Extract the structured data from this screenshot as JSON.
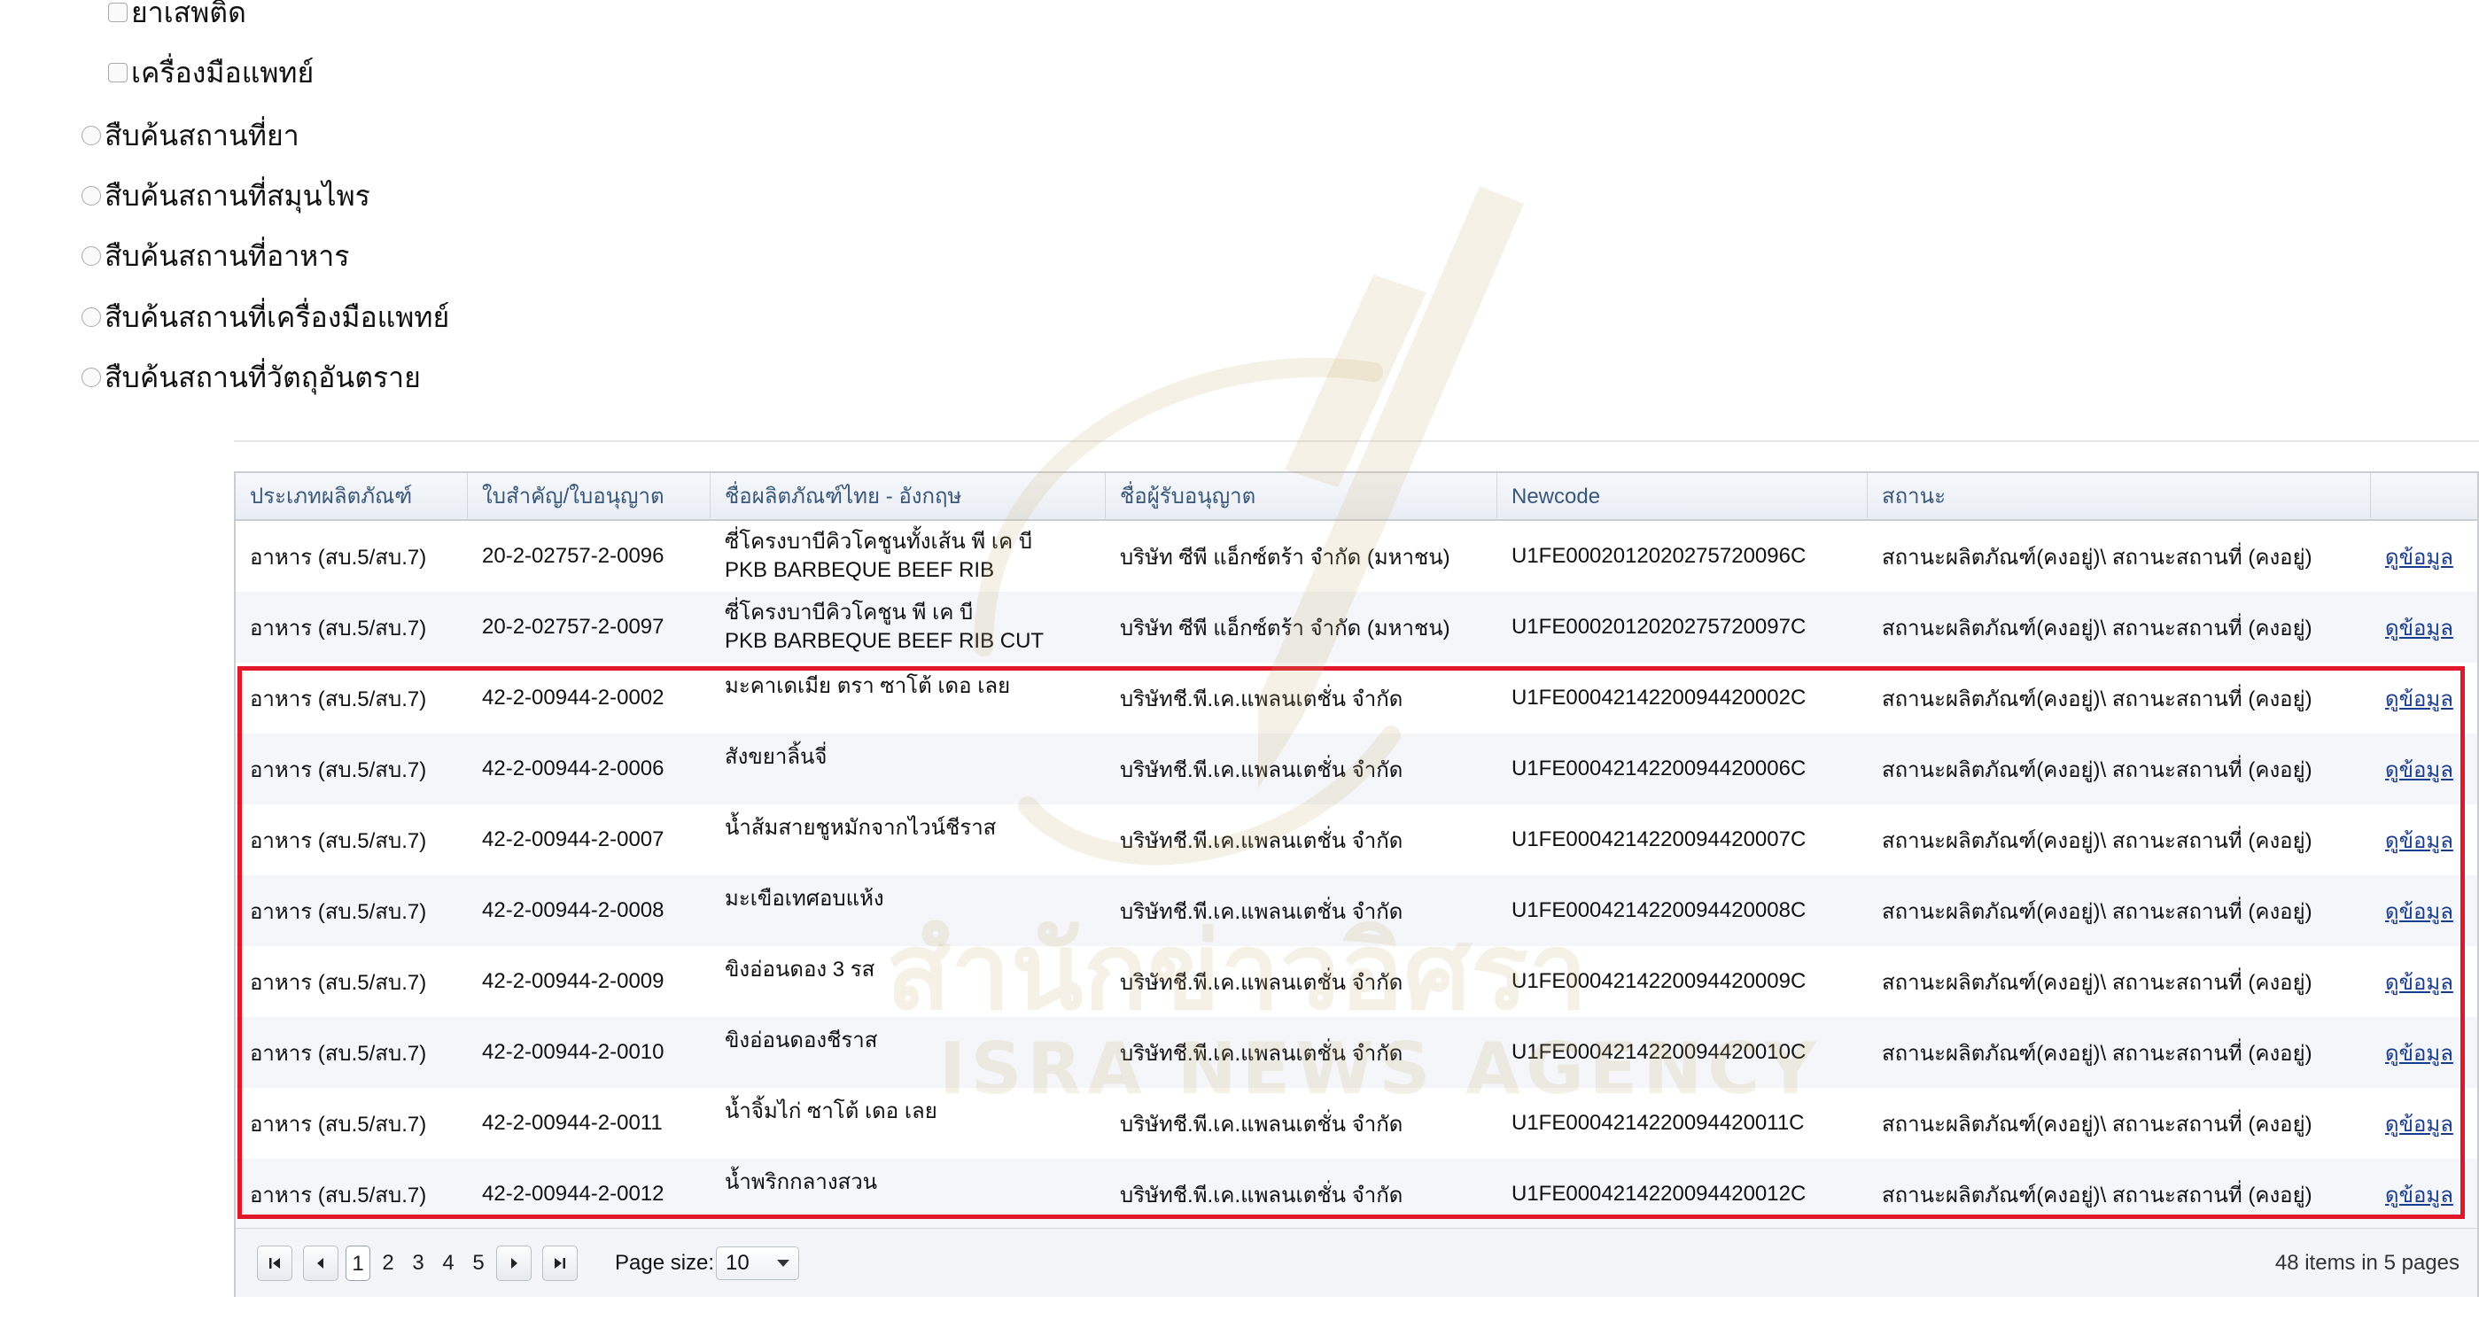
{
  "options": [
    {
      "kind": "checkbox",
      "label": "ยาเสพติด"
    },
    {
      "kind": "checkbox",
      "label": "เครื่องมือแพทย์"
    },
    {
      "kind": "radio",
      "label": "สืบค้นสถานที่ยา"
    },
    {
      "kind": "radio",
      "label": "สืบค้นสถานที่สมุนไพร"
    },
    {
      "kind": "radio",
      "label": "สืบค้นสถานที่อาหาร"
    },
    {
      "kind": "radio",
      "label": "สืบค้นสถานที่เครื่องมือแพทย์"
    },
    {
      "kind": "radio",
      "label": "สืบค้นสถานที่วัตถุอันตราย"
    }
  ],
  "grid": {
    "columns": [
      "ประเภทผลิตภัณฑ์",
      "ใบสำคัญ/ใบอนุญาต",
      "ชื่อผลิตภัณฑ์ไทย - อังกฤษ",
      "ชื่อผู้รับอนุญาต",
      "Newcode",
      "สถานะ",
      ""
    ],
    "rows": [
      {
        "type": "อาหาร (สบ.5/สบ.7)",
        "license": "20-2-02757-2-0096",
        "name_th": "ซี่โครงบาบีคิวโคชูนทั้งเส้น พี เค บี",
        "name_en": "PKB BARBEQUE BEEF RIB",
        "licensee": "บริษัท ซีพี แอ็กซ์ตร้า จำกัด (มหาชน)",
        "newcode": "U1FE0002012020275720096C",
        "status": "สถานะผลิตภัณฑ์(คงอยู่)\\ สถานะสถานที่ (คงอยู่)",
        "action": "ดูข้อมูล"
      },
      {
        "type": "อาหาร (สบ.5/สบ.7)",
        "license": "20-2-02757-2-0097",
        "name_th": "ซี่โครงบาบีคิวโคชูน พี เค บี",
        "name_en": "PKB BARBEQUE BEEF RIB CUT",
        "licensee": "บริษัท ซีพี แอ็กซ์ตร้า จำกัด (มหาชน)",
        "newcode": "U1FE0002012020275720097C",
        "status": "สถานะผลิตภัณฑ์(คงอยู่)\\ สถานะสถานที่ (คงอยู่)",
        "action": "ดูข้อมูล"
      },
      {
        "type": "อาหาร (สบ.5/สบ.7)",
        "license": "42-2-00944-2-0002",
        "name_th": "มะคาเดเมีย ตรา ซาโต้ เดอ เลย",
        "name_en": "",
        "licensee": "บริษัทชี.พี.เค.แพลนเตชั่น จำกัด",
        "newcode": "U1FE0004214220094420002C",
        "status": "สถานะผลิตภัณฑ์(คงอยู่)\\ สถานะสถานที่ (คงอยู่)",
        "action": "ดูข้อมูล"
      },
      {
        "type": "อาหาร (สบ.5/สบ.7)",
        "license": "42-2-00944-2-0006",
        "name_th": "สังขยาลิ้นจี่",
        "name_en": "",
        "licensee": "บริษัทชี.พี.เค.แพลนเตชั่น จำกัด",
        "newcode": "U1FE0004214220094420006C",
        "status": "สถานะผลิตภัณฑ์(คงอยู่)\\ สถานะสถานที่ (คงอยู่)",
        "action": "ดูข้อมูล"
      },
      {
        "type": "อาหาร (สบ.5/สบ.7)",
        "license": "42-2-00944-2-0007",
        "name_th": "น้ำส้มสายชูหมักจากไวน์ชีราส",
        "name_en": "",
        "licensee": "บริษัทชี.พี.เค.แพลนเตชั่น จำกัด",
        "newcode": "U1FE0004214220094420007C",
        "status": "สถานะผลิตภัณฑ์(คงอยู่)\\ สถานะสถานที่ (คงอยู่)",
        "action": "ดูข้อมูล"
      },
      {
        "type": "อาหาร (สบ.5/สบ.7)",
        "license": "42-2-00944-2-0008",
        "name_th": "มะเขือเทศอบแห้ง",
        "name_en": "",
        "licensee": "บริษัทชี.พี.เค.แพลนเตชั่น จำกัด",
        "newcode": "U1FE0004214220094420008C",
        "status": "สถานะผลิตภัณฑ์(คงอยู่)\\ สถานะสถานที่ (คงอยู่)",
        "action": "ดูข้อมูล"
      },
      {
        "type": "อาหาร (สบ.5/สบ.7)",
        "license": "42-2-00944-2-0009",
        "name_th": "ขิงอ่อนดอง 3 รส",
        "name_en": "",
        "licensee": "บริษัทชี.พี.เค.แพลนเตชั่น จำกัด",
        "newcode": "U1FE0004214220094420009C",
        "status": "สถานะผลิตภัณฑ์(คงอยู่)\\ สถานะสถานที่ (คงอยู่)",
        "action": "ดูข้อมูล"
      },
      {
        "type": "อาหาร (สบ.5/สบ.7)",
        "license": "42-2-00944-2-0010",
        "name_th": "ขิงอ่อนดองชีราส",
        "name_en": "",
        "licensee": "บริษัทชี.พี.เค.แพลนเตชั่น จำกัด",
        "newcode": "U1FE0004214220094420010C",
        "status": "สถานะผลิตภัณฑ์(คงอยู่)\\ สถานะสถานที่ (คงอยู่)",
        "action": "ดูข้อมูล"
      },
      {
        "type": "อาหาร (สบ.5/สบ.7)",
        "license": "42-2-00944-2-0011",
        "name_th": "น้ำจิ้มไก่ ซาโต้ เดอ เลย",
        "name_en": "",
        "licensee": "บริษัทชี.พี.เค.แพลนเตชั่น จำกัด",
        "newcode": "U1FE0004214220094420011C",
        "status": "สถานะผลิตภัณฑ์(คงอยู่)\\ สถานะสถานที่ (คงอยู่)",
        "action": "ดูข้อมูล"
      },
      {
        "type": "อาหาร (สบ.5/สบ.7)",
        "license": "42-2-00944-2-0012",
        "name_th": "น้ำพริกกลางสวน",
        "name_en": "",
        "licensee": "บริษัทชี.พี.เค.แพลนเตชั่น จำกัด",
        "newcode": "U1FE0004214220094420012C",
        "status": "สถานะผลิตภัณฑ์(คงอยู่)\\ สถานะสถานที่ (คงอยู่)",
        "action": "ดูข้อมูล"
      }
    ]
  },
  "pager": {
    "pages": [
      "1",
      "2",
      "3",
      "4",
      "5"
    ],
    "current": "1",
    "page_size_label": "Page size:",
    "page_size": "10",
    "info_count": "48",
    "info_items_in": "items in",
    "info_pages": "5",
    "info_pages_word": "pages"
  },
  "watermark": {
    "text_th": "สำนักข่าวอิศรา",
    "text_en": "ISRA NEWS AGENCY",
    "color": "#c8a864"
  },
  "colors": {
    "header_text": "#39577a",
    "link": "#1a3c8f",
    "highlight": "#e0182a"
  }
}
